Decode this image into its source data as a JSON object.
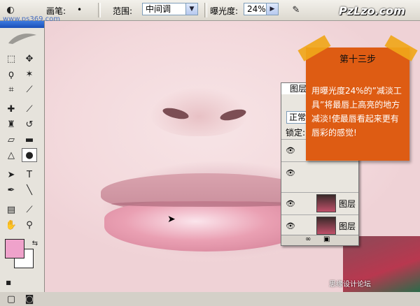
{
  "options_bar": {
    "brush_label": "画笔:",
    "brush_size": "•",
    "range_label": "范围:",
    "range_value": "中间调",
    "exposure_label": "曝光度:",
    "exposure_value": "24%"
  },
  "layers_panel": {
    "tab_label": "图层",
    "blend_mode": "正常",
    "lock_label": "锁定:",
    "layers": [
      {
        "name": ""
      },
      {
        "name": ""
      },
      {
        "name": "图层"
      },
      {
        "name": "图层"
      }
    ]
  },
  "note": {
    "title": "第十三步",
    "body": "用曝光度24%的”减淡工具”将最唇上高亮的地方减淡!使最唇看起来更有唇彩的感觉!"
  },
  "branding": {
    "logo": "PzLzo.com",
    "watermark_top": "www.ps369.com",
    "watermark_bottom": "思缘设计论坛"
  },
  "colors": {
    "foreground": "#efa2cb",
    "background": "#ffffff",
    "note": "#de5c13",
    "tape": "#f0a61a"
  }
}
